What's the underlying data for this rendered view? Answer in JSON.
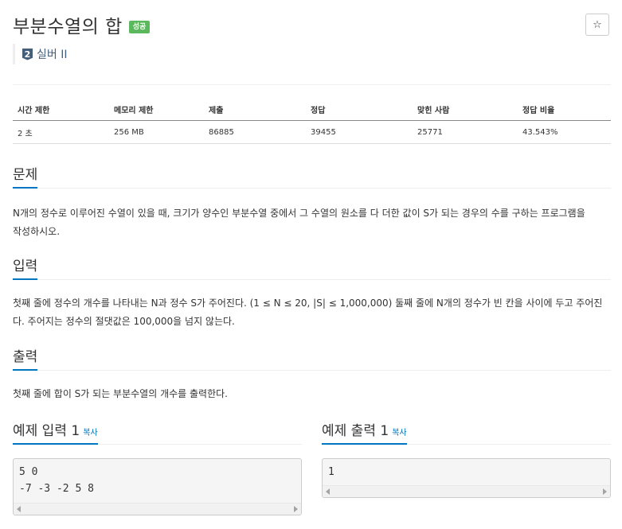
{
  "problem": {
    "title": "부분수열의 합",
    "status_badge": "성공",
    "star_icon": "☆",
    "tier": {
      "number": "2",
      "label": "실버 II"
    }
  },
  "info_table": {
    "headers": [
      "시간 제한",
      "메모리 제한",
      "제출",
      "정답",
      "맞힌 사람",
      "정답 비율"
    ],
    "values": [
      "2 초",
      "256 MB",
      "86885",
      "39455",
      "25771",
      "43.543%"
    ]
  },
  "sections": {
    "problem": {
      "title": "문제",
      "lines": [
        "N개의 정수로 이루어진 수열이 있을 때, 크기가 양수인 부분수열 중에서 그 수열의 원소를 다 더한 값이 S가 되는 경우의 수를 구하는 프로그램을",
        "작성하시오."
      ]
    },
    "input": {
      "title": "입력",
      "lines": [
        "첫째 줄에 정수의 개수를 나타내는 N과 정수 S가 주어진다. (1 ≤ N ≤ 20, |S| ≤ 1,000,000) 둘째 줄에 N개의 정수가 빈 칸을 사이에 두고 주어진",
        "다. 주어지는 정수의 절댓값은 100,000을 넘지 않는다."
      ]
    },
    "output": {
      "title": "출력",
      "lines": [
        "첫째 줄에 합이 S가 되는 부분수열의 개수를 출력한다."
      ]
    }
  },
  "examples": {
    "input": {
      "title": "예제 입력 1",
      "copy_label": "복사",
      "lines": [
        "5 0",
        "-7 -3 -2 5 8"
      ]
    },
    "output": {
      "title": "예제 출력 1",
      "copy_label": "복사",
      "lines": [
        "1"
      ]
    }
  },
  "colors": {
    "accent": "#0076c0",
    "success": "#5cb85c",
    "tier": "#435f7a"
  }
}
